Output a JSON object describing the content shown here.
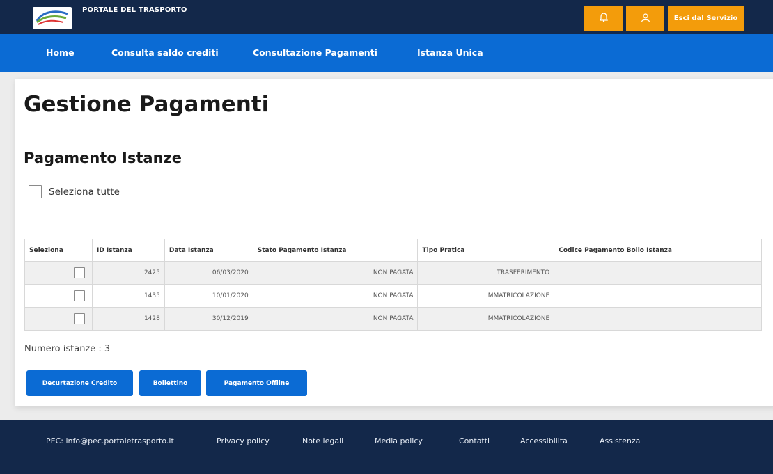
{
  "header": {
    "brand": "PORTALE DEL TRASPORTO",
    "exit_label": "Esci dal Servizio",
    "accent": "#f39c0b",
    "bar_color": "#13284a"
  },
  "nav": {
    "color": "#0b6bd4",
    "items": [
      "Home",
      "Consulta saldo crediti",
      "Consultazione Pagamenti",
      "Istanza Unica"
    ]
  },
  "page": {
    "title": "Gestione Pagamenti",
    "section": "Pagamento Istanze",
    "select_all": "Seleziona tutte",
    "count_text": "Numero istanze : 3"
  },
  "table": {
    "headers": [
      "Seleziona",
      "ID Istanza",
      "Data Istanza",
      "Stato Pagamento Istanza",
      "Tipo Pratica",
      "Codice Pagamento Bollo Istanza"
    ],
    "rows": [
      {
        "id": "2425",
        "data": "06/03/2020",
        "stato": "NON PAGATA",
        "tipo": "TRASFERIMENTO",
        "codice": ""
      },
      {
        "id": "1435",
        "data": "10/01/2020",
        "stato": "NON PAGATA",
        "tipo": "IMMATRICOLAZIONE",
        "codice": ""
      },
      {
        "id": "1428",
        "data": "30/12/2019",
        "stato": "NON PAGATA",
        "tipo": "IMMATRICOLAZIONE",
        "codice": ""
      }
    ]
  },
  "buttons": {
    "decurtazione": "Decurtazione Credito",
    "bollettino": "Bollettino",
    "offline": "Pagamento Offline"
  },
  "footer": {
    "pec": "PEC: info@pec.portaletrasporto.it",
    "links": [
      "Privacy policy",
      "Note legali",
      "Media policy",
      "Contatti",
      "Accessibilita",
      "Assistenza"
    ]
  }
}
